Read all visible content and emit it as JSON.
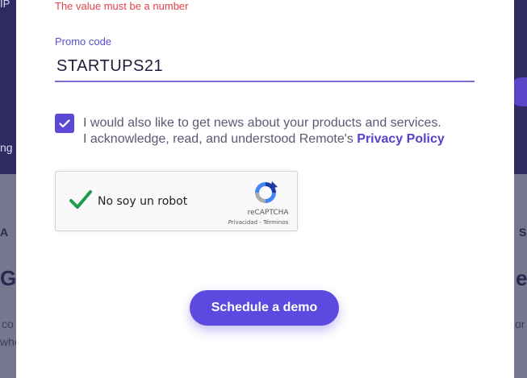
{
  "background": {
    "fragments": {
      "top_left": "IP",
      "mid_left": "ng",
      "caps_left": "A",
      "caps_right": "S",
      "heading_left": "G",
      "heading_right": "e",
      "line1_left": "co",
      "line2_left": "whe",
      "line1_right": "or"
    },
    "colors": {
      "overlay": "#6c6a8e",
      "header": "#2f2a62"
    }
  },
  "form": {
    "error_message": "The value must be a number",
    "promo_label": "Promo code",
    "promo_value": "STARTUPS21",
    "checkbox_checked": true,
    "consent_line1": "I would also like to get news about your products and services.",
    "consent_line2_prefix": "I acknowledge, read, and understood Remote's ",
    "privacy_link": "Privacy Policy"
  },
  "recaptcha": {
    "label": "No soy un robot",
    "brand": "reCAPTCHA",
    "privacy": "Privacidad",
    "separator": " - ",
    "terms": "Términos",
    "checked": true
  },
  "cta": {
    "label": "Schedule a demo"
  },
  "colors": {
    "accent": "#5b49e0",
    "error": "#e0454b",
    "label": "#5a4fd0",
    "check_green": "#1a9e4b"
  }
}
